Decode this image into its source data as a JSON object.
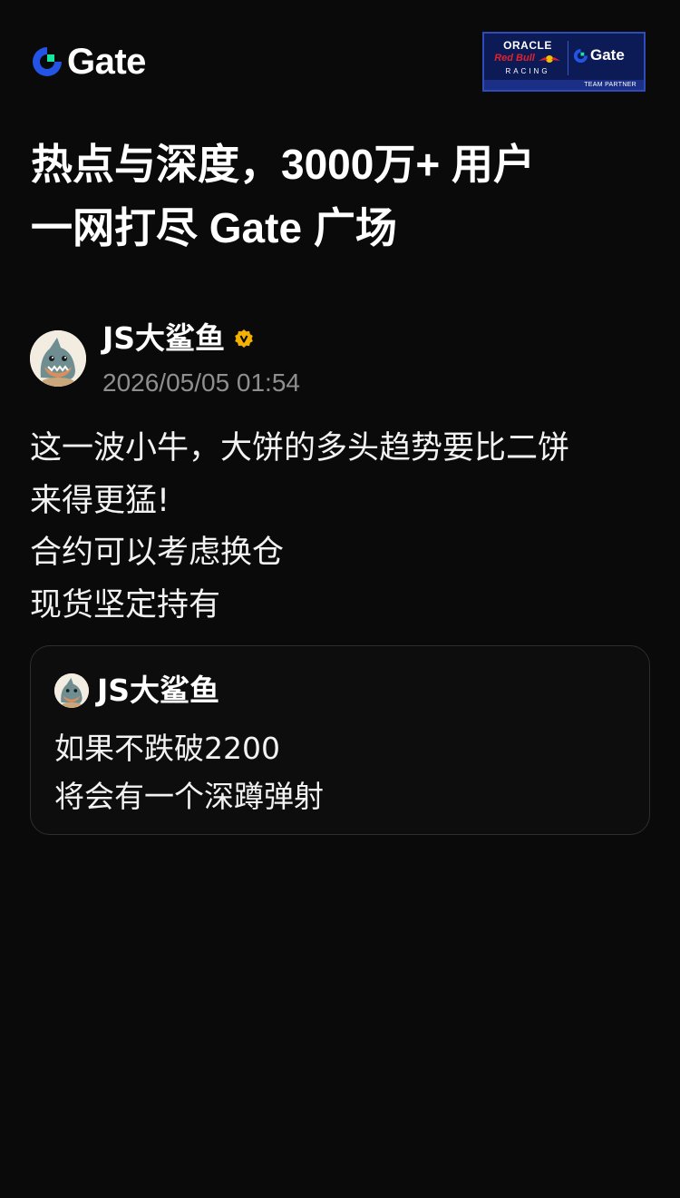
{
  "brand": {
    "name": "Gate",
    "accent_blue": "#2354e6",
    "accent_green": "#17e6a1"
  },
  "partner_badge": {
    "oracle": "ORACLE",
    "redbull": "Red Bull",
    "racing": "RACING",
    "gate": "Gate",
    "strip": "TEAM PARTNER"
  },
  "headline": {
    "line1": "热点与深度，3000万+ 用户",
    "line2": "一网打尽 Gate 广场"
  },
  "post": {
    "author": "JS大鲨鱼",
    "verified_icon": "verified-badge-icon",
    "time": "2026/05/05 01:54",
    "lines": [
      "这一波小牛，大饼的多头趋势要比二饼",
      "来得更猛!",
      "合约可以考虑换仓",
      "现货坚定持有"
    ]
  },
  "quote": {
    "author": "JS大鲨鱼",
    "lines": [
      "如果不跌破2200",
      "将会有一个深蹲弹射"
    ]
  },
  "colors": {
    "background": "#0a0a0a",
    "muted_text": "#8f8f8f",
    "card_border": "#2e2e2e",
    "verified": "#f5b100"
  }
}
